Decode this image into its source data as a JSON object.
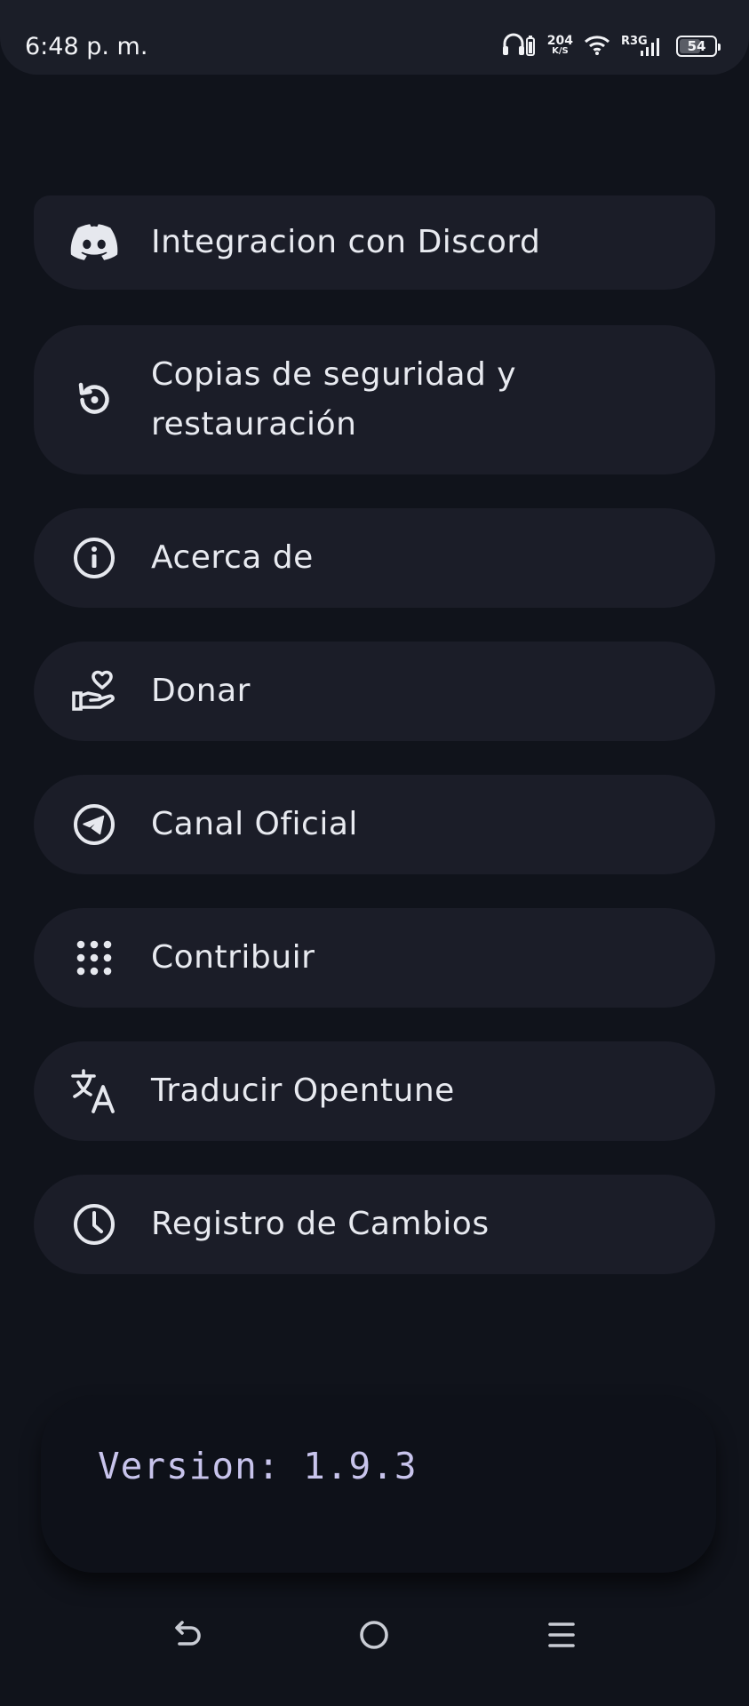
{
  "status_bar": {
    "time": "6:48 p. m.",
    "net_speed_value": "204",
    "net_speed_unit": "K/S",
    "carrier_label": "R3G",
    "battery_percent": "54",
    "battery_level": 0.54,
    "icons": [
      "headphones-icon",
      "wifi-icon",
      "signal-icon",
      "battery-icon"
    ]
  },
  "settings": {
    "items": [
      {
        "label": "Integracion con Discord",
        "icon": "discord-icon"
      },
      {
        "label": "Copias de seguridad y restauración",
        "icon": "backup-restore-icon"
      },
      {
        "label": "Acerca de",
        "icon": "info-icon"
      },
      {
        "label": "Donar",
        "icon": "donate-icon"
      },
      {
        "label": "Canal Oficial",
        "icon": "telegram-icon"
      },
      {
        "label": "Contribuir",
        "icon": "grid-dots-icon"
      },
      {
        "label": "Traducir Opentune",
        "icon": "translate-icon"
      },
      {
        "label": "Registro de Cambios",
        "icon": "clock-icon"
      }
    ]
  },
  "footer": {
    "version_text": "Version: 1.9.3"
  },
  "nav_bar": {
    "icons": [
      "back-icon",
      "home-icon",
      "menu-icon"
    ]
  },
  "colors": {
    "background": "#10131b",
    "card": "#1b1d28",
    "text": "#e8eaf0",
    "version_text": "#c8c4ec"
  }
}
